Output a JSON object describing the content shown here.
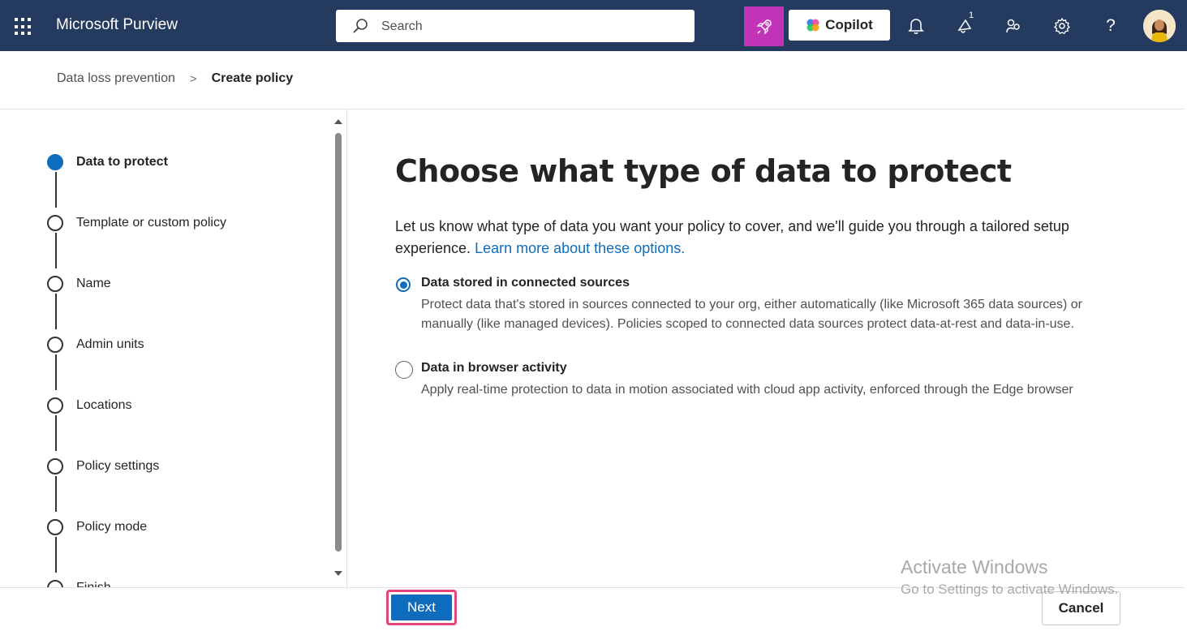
{
  "header": {
    "app_title": "Microsoft Purview",
    "search_placeholder": "Search",
    "copilot_label": "Copilot",
    "notification_count": "1",
    "brand_color": "#243a5e",
    "rocket_color": "#c233b8",
    "icons": [
      "waffle-icon",
      "search-icon",
      "rocket-icon",
      "copilot-icon",
      "bell-icon",
      "announcement-icon",
      "share-icon",
      "gear-icon",
      "help-icon",
      "avatar"
    ]
  },
  "breadcrumb": {
    "parent": "Data loss prevention",
    "separator": ">",
    "current": "Create policy"
  },
  "steps": [
    {
      "label": "Data to protect",
      "active": true
    },
    {
      "label": "Template or custom policy",
      "active": false
    },
    {
      "label": "Name",
      "active": false
    },
    {
      "label": "Admin units",
      "active": false
    },
    {
      "label": "Locations",
      "active": false
    },
    {
      "label": "Policy settings",
      "active": false
    },
    {
      "label": "Policy mode",
      "active": false
    },
    {
      "label": "Finish",
      "active": false
    }
  ],
  "main": {
    "title": "Choose what type of data to protect",
    "intro": "Let us know what type of data you want your policy to cover, and we'll guide you through a tailored setup experience. ",
    "intro_link": "Learn more about these options.",
    "options": [
      {
        "title": "Data stored in connected sources",
        "description": "Protect data that's stored in sources connected to your org, either automatically (like Microsoft 365 data sources) or manually (like managed devices). Policies scoped to connected data sources protect data-at-rest and data-in-use.",
        "selected": true
      },
      {
        "title": "Data in browser activity",
        "description": "Apply real-time protection to data in motion associated with cloud app activity, enforced through the Edge browser",
        "selected": false
      }
    ]
  },
  "footer": {
    "next_label": "Next",
    "cancel_label": "Cancel"
  },
  "watermark": {
    "line1": "Activate Windows",
    "line2": "Go to Settings to activate Windows."
  },
  "colors": {
    "accent": "#0f6cbd",
    "highlight_border": "#e0457b"
  }
}
